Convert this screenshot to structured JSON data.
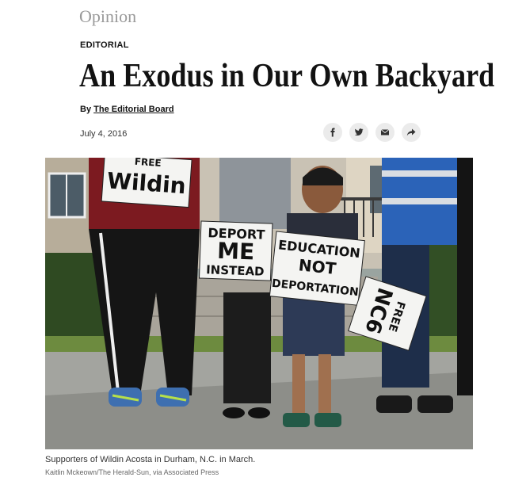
{
  "section": "Opinion",
  "kicker": "EDITORIAL",
  "headline": "An Exodus in Our Own Backyard",
  "byline": {
    "prefix": "By",
    "author": "The Editorial Board"
  },
  "date": "July 4, 2016",
  "share": [
    {
      "icon": "facebook-icon"
    },
    {
      "icon": "twitter-icon"
    },
    {
      "icon": "email-icon"
    },
    {
      "icon": "share-icon"
    }
  ],
  "photo": {
    "signs": {
      "wildin_prefix": "FREE",
      "wildin": "Wildin",
      "deport_line1": "DEPORT",
      "deport_line2": "ME",
      "deport_line3": "INSTEAD",
      "education_line1": "EDUCATION",
      "education_line2": "NOT",
      "education_line3": "DEPORTATION",
      "nc6_line1": "FREE",
      "nc6_line2": "NC6"
    }
  },
  "caption": "Supporters of Wildin Acosta in Durham, N.C. in March.",
  "credit": "Kaitlin Mckeown/The Herald-Sun, via Associated Press"
}
